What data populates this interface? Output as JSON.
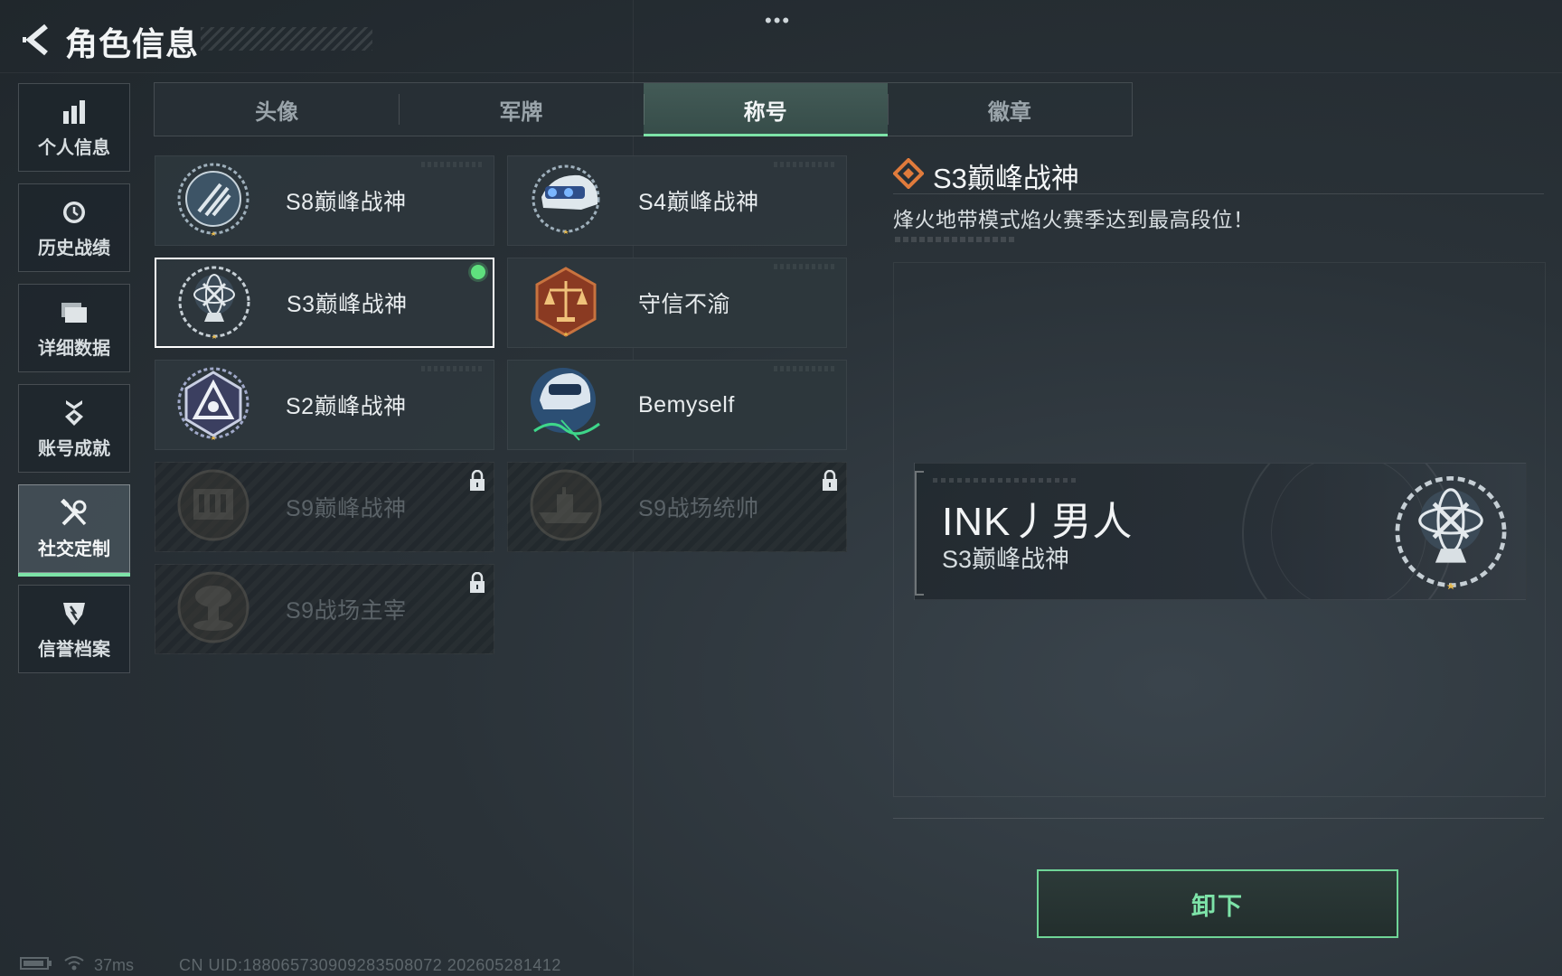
{
  "header": {
    "title": "角色信息",
    "back_icon": "back-arrow-icon",
    "more_icon": "more-dots-icon"
  },
  "sidebar": {
    "items": [
      {
        "label": "个人信息",
        "icon": "bar-chart-icon",
        "active": false
      },
      {
        "label": "历史战绩",
        "icon": "clock-icon",
        "active": false
      },
      {
        "label": "详细数据",
        "icon": "folder-icon",
        "active": false
      },
      {
        "label": "账号成就",
        "icon": "medal-icon",
        "active": false
      },
      {
        "label": "社交定制",
        "icon": "tools-icon",
        "active": true
      },
      {
        "label": "信誉档案",
        "icon": "shield-icon",
        "active": false
      }
    ]
  },
  "tabs": [
    {
      "label": "头像",
      "active": false
    },
    {
      "label": "军牌",
      "active": false
    },
    {
      "label": "称号",
      "active": true
    },
    {
      "label": "徽章",
      "active": false
    }
  ],
  "titles": [
    {
      "name": "S8巅峰战神",
      "emblem": "s8-emblem-icon",
      "locked": false,
      "selected": false,
      "equipped": false
    },
    {
      "name": "S4巅峰战神",
      "emblem": "s4-emblem-icon",
      "locked": false,
      "selected": false,
      "equipped": false
    },
    {
      "name": "S3巅峰战神",
      "emblem": "s3-emblem-icon",
      "locked": false,
      "selected": true,
      "equipped": true
    },
    {
      "name": "守信不渝",
      "emblem": "scales-emblem-icon",
      "locked": false,
      "selected": false,
      "equipped": false
    },
    {
      "name": "S2巅峰战神",
      "emblem": "s2-emblem-icon",
      "locked": false,
      "selected": false,
      "equipped": false
    },
    {
      "name": "Bemyself",
      "emblem": "bemyself-emblem-icon",
      "locked": false,
      "selected": false,
      "equipped": false
    },
    {
      "name": "S9巅峰战神",
      "emblem": "s9-emblem-icon",
      "locked": true,
      "selected": false,
      "equipped": false
    },
    {
      "name": "S9战场统帅",
      "emblem": "warship-emblem-icon",
      "locked": true,
      "selected": false,
      "equipped": false
    },
    {
      "name": "S9战场主宰",
      "emblem": "mushroom-cloud-emblem-icon",
      "locked": true,
      "selected": false,
      "equipped": false
    }
  ],
  "detail": {
    "title": "S3巅峰战神",
    "description": "烽火地带模式焰火赛季达到最高段位！",
    "icon": "diamond-icon",
    "icon_color": "#e07b3c"
  },
  "preview": {
    "player_name": "INK丿男人",
    "title": "S3巅峰战神",
    "emblem": "s3-emblem-icon"
  },
  "actions": {
    "unequip_label": "卸下"
  },
  "footer": {
    "ping": "37ms",
    "uid": "CN UID:18806573090928350807​2 202605281412"
  },
  "colors": {
    "accent": "#7de3a8",
    "equipped_dot": "#5fe07e",
    "selected_border": "#ffffff"
  }
}
